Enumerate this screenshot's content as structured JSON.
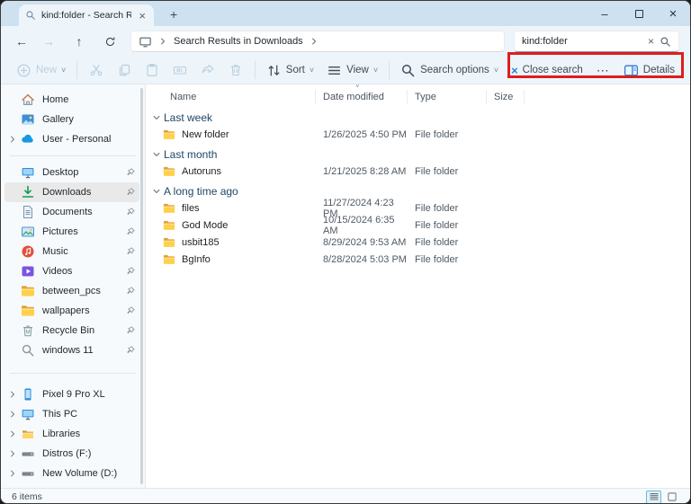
{
  "window": {
    "tab_title": "kind:folder - Search Results in",
    "icons": {
      "close": "×",
      "minimize": "–",
      "new_tab": "+"
    }
  },
  "nav": {
    "back": "←",
    "forward": "→",
    "up": "↑",
    "breadcrumb": "Search Results in Downloads",
    "search_value": "kind:folder",
    "search_clear": "×"
  },
  "toolbar": {
    "new_label": "New",
    "sort_label": "Sort",
    "view_label": "View",
    "search_options_label": "Search options",
    "close_search_label": "Close search",
    "close_search_x": "×",
    "more_label": "⋯",
    "details_label": "Details",
    "caret": "˅"
  },
  "columns": {
    "name": "Name",
    "date": "Date modified",
    "type": "Type",
    "size": "Size",
    "sort_caret": "˅"
  },
  "groups": [
    {
      "label": "Last week",
      "items": [
        {
          "name": "New folder",
          "date": "1/26/2025 4:50 PM",
          "type": "File folder"
        }
      ]
    },
    {
      "label": "Last month",
      "items": [
        {
          "name": "Autoruns",
          "date": "1/21/2025 8:28 AM",
          "type": "File folder"
        }
      ]
    },
    {
      "label": "A long time ago",
      "items": [
        {
          "name": "files",
          "date": "11/27/2024 4:23 PM",
          "type": "File folder"
        },
        {
          "name": "God Mode",
          "date": "10/15/2024 6:35 AM",
          "type": "File folder"
        },
        {
          "name": "usbit185",
          "date": "8/29/2024 9:53 AM",
          "type": "File folder"
        },
        {
          "name": "BgInfo",
          "date": "8/28/2024 5:03 PM",
          "type": "File folder"
        }
      ]
    }
  ],
  "sidebar": {
    "top": [
      {
        "label": "Home"
      },
      {
        "label": "Gallery"
      },
      {
        "label": "User - Personal"
      }
    ],
    "pinned": [
      {
        "label": "Desktop"
      },
      {
        "label": "Downloads"
      },
      {
        "label": "Documents"
      },
      {
        "label": "Pictures"
      },
      {
        "label": "Music"
      },
      {
        "label": "Videos"
      },
      {
        "label": "between_pcs"
      },
      {
        "label": "wallpapers"
      },
      {
        "label": "Recycle Bin"
      },
      {
        "label": "windows 11"
      }
    ],
    "tree": [
      {
        "label": "Pixel 9 Pro XL"
      },
      {
        "label": "This PC"
      },
      {
        "label": "Libraries"
      },
      {
        "label": "Distros (F:)"
      },
      {
        "label": "New Volume (D:)"
      }
    ]
  },
  "status": {
    "count": "6 items"
  },
  "colors": {
    "annotation_red": "#dd1e1e",
    "folder_yellow": "#ffd04a",
    "download_green": "#0f9d58",
    "titlebar_blue": "#cde1f0"
  }
}
